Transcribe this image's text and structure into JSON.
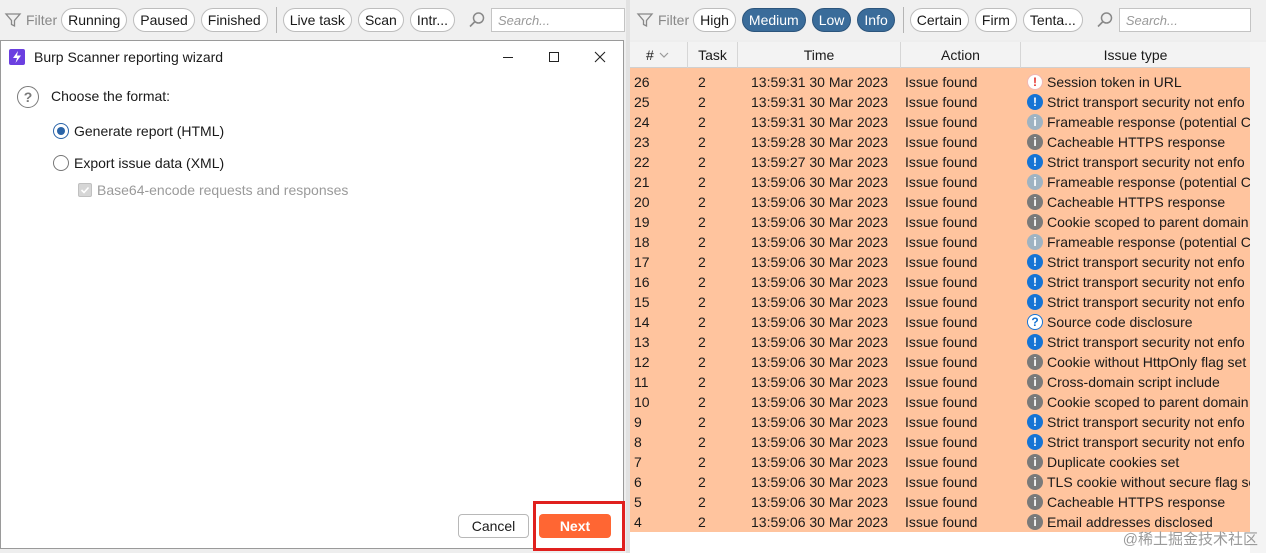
{
  "left_filter": {
    "label": "Filter",
    "pills": [
      "Running",
      "Paused",
      "Finished"
    ],
    "pills2": [
      "Live task",
      "Scan",
      "Intr..."
    ],
    "search_placeholder": "Search..."
  },
  "right_filter": {
    "label": "Filter",
    "severity": [
      {
        "label": "High",
        "active": false
      },
      {
        "label": "Medium",
        "active": true
      },
      {
        "label": "Low",
        "active": true
      },
      {
        "label": "Info",
        "active": true
      }
    ],
    "confidence": [
      "Certain",
      "Firm",
      "Tenta..."
    ],
    "search_placeholder": "Search..."
  },
  "dialog": {
    "title": "Burp Scanner reporting wizard",
    "prompt": "Choose the format:",
    "option_html": "Generate report (HTML)",
    "option_xml": "Export issue data (XML)",
    "option_base64": "Base64-encode requests and responses",
    "cancel_label": "Cancel",
    "next_label": "Next",
    "selected": "html"
  },
  "table": {
    "headers": {
      "num": "#",
      "task": "Task",
      "time": "Time",
      "action": "Action",
      "issue": "Issue type"
    },
    "rows": [
      {
        "num": "26",
        "task": "2",
        "time": "13:59:31 30 Mar 2023",
        "action": "Issue found",
        "severity": "high",
        "issue": "Session token in URL"
      },
      {
        "num": "25",
        "task": "2",
        "time": "13:59:31 30 Mar 2023",
        "action": "Issue found",
        "severity": "medium",
        "issue": "Strict transport security not enfo"
      },
      {
        "num": "24",
        "task": "2",
        "time": "13:59:31 30 Mar 2023",
        "action": "Issue found",
        "severity": "tentative",
        "issue": "Frameable response (potential Cli"
      },
      {
        "num": "23",
        "task": "2",
        "time": "13:59:28 30 Mar 2023",
        "action": "Issue found",
        "severity": "info",
        "issue": "Cacheable HTTPS response"
      },
      {
        "num": "22",
        "task": "2",
        "time": "13:59:27 30 Mar 2023",
        "action": "Issue found",
        "severity": "medium",
        "issue": "Strict transport security not enfo"
      },
      {
        "num": "21",
        "task": "2",
        "time": "13:59:06 30 Mar 2023",
        "action": "Issue found",
        "severity": "tentative",
        "issue": "Frameable response (potential Cli"
      },
      {
        "num": "20",
        "task": "2",
        "time": "13:59:06 30 Mar 2023",
        "action": "Issue found",
        "severity": "info",
        "issue": "Cacheable HTTPS response"
      },
      {
        "num": "19",
        "task": "2",
        "time": "13:59:06 30 Mar 2023",
        "action": "Issue found",
        "severity": "info",
        "issue": "Cookie scoped to parent domain"
      },
      {
        "num": "18",
        "task": "2",
        "time": "13:59:06 30 Mar 2023",
        "action": "Issue found",
        "severity": "tentative",
        "issue": "Frameable response (potential Cli"
      },
      {
        "num": "17",
        "task": "2",
        "time": "13:59:06 30 Mar 2023",
        "action": "Issue found",
        "severity": "medium",
        "issue": "Strict transport security not enfo"
      },
      {
        "num": "16",
        "task": "2",
        "time": "13:59:06 30 Mar 2023",
        "action": "Issue found",
        "severity": "medium",
        "issue": "Strict transport security not enfo"
      },
      {
        "num": "15",
        "task": "2",
        "time": "13:59:06 30 Mar 2023",
        "action": "Issue found",
        "severity": "medium",
        "issue": "Strict transport security not enfo"
      },
      {
        "num": "14",
        "task": "2",
        "time": "13:59:06 30 Mar 2023",
        "action": "Issue found",
        "severity": "question",
        "issue": "Source code disclosure"
      },
      {
        "num": "13",
        "task": "2",
        "time": "13:59:06 30 Mar 2023",
        "action": "Issue found",
        "severity": "medium",
        "issue": "Strict transport security not enfo"
      },
      {
        "num": "12",
        "task": "2",
        "time": "13:59:06 30 Mar 2023",
        "action": "Issue found",
        "severity": "info",
        "issue": "Cookie without HttpOnly flag set"
      },
      {
        "num": "11",
        "task": "2",
        "time": "13:59:06 30 Mar 2023",
        "action": "Issue found",
        "severity": "info",
        "issue": "Cross-domain script include"
      },
      {
        "num": "10",
        "task": "2",
        "time": "13:59:06 30 Mar 2023",
        "action": "Issue found",
        "severity": "info",
        "issue": "Cookie scoped to parent domain"
      },
      {
        "num": "9",
        "task": "2",
        "time": "13:59:06 30 Mar 2023",
        "action": "Issue found",
        "severity": "medium",
        "issue": "Strict transport security not enfo"
      },
      {
        "num": "8",
        "task": "2",
        "time": "13:59:06 30 Mar 2023",
        "action": "Issue found",
        "severity": "medium",
        "issue": "Strict transport security not enfo"
      },
      {
        "num": "7",
        "task": "2",
        "time": "13:59:06 30 Mar 2023",
        "action": "Issue found",
        "severity": "info",
        "issue": "Duplicate cookies set"
      },
      {
        "num": "6",
        "task": "2",
        "time": "13:59:06 30 Mar 2023",
        "action": "Issue found",
        "severity": "info",
        "issue": "TLS cookie without secure flag se"
      },
      {
        "num": "5",
        "task": "2",
        "time": "13:59:06 30 Mar 2023",
        "action": "Issue found",
        "severity": "info",
        "issue": "Cacheable HTTPS response"
      },
      {
        "num": "4",
        "task": "2",
        "time": "13:59:06 30 Mar 2023",
        "action": "Issue found",
        "severity": "info",
        "issue": "Email addresses disclosed"
      }
    ]
  },
  "watermark": "@稀土掘金技术社区",
  "colors": {
    "row_bg": "#ffc49e",
    "next_button": "#ff6633",
    "highlight": "#e0201e",
    "pill_active": "#3a6c9a"
  }
}
